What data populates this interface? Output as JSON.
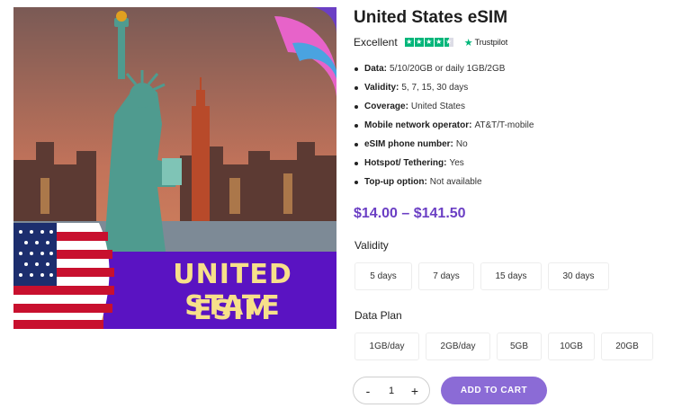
{
  "product": {
    "title": "United States eSIM",
    "image_text_line1": "UNITED STATE",
    "image_text_line2": "ESIM"
  },
  "rating": {
    "label": "Excellent",
    "stars": 4.5,
    "provider": "Trustpilot"
  },
  "features": [
    {
      "key": "Data:",
      "value": "5/10/20GB or daily 1GB/2GB"
    },
    {
      "key": "Validity:",
      "value": "5, 7, 15, 30 days"
    },
    {
      "key": "Coverage:",
      "value": "United States"
    },
    {
      "key": "Mobile network operator:",
      "value": "AT&T/T-mobile"
    },
    {
      "key": "eSIM phone number:",
      "value": "No"
    },
    {
      "key": "Hotspot/ Tethering:",
      "value": "Yes"
    },
    {
      "key": "Top-up option:",
      "value": "Not available"
    }
  ],
  "price": "$14.00 – $141.50",
  "validity": {
    "label": "Validity",
    "options": [
      "5 days",
      "7 days",
      "15 days",
      "30 days"
    ]
  },
  "data_plan": {
    "label": "Data Plan",
    "options": [
      "1GB/day",
      "2GB/day",
      "5GB",
      "10GB",
      "20GB"
    ]
  },
  "quantity": {
    "minus": "-",
    "value": "1",
    "plus": "+"
  },
  "add_to_cart": "ADD TO CART",
  "colors": {
    "accent": "#6b3fc4",
    "button": "#8b6bd6",
    "trustpilot": "#00b67a",
    "banner": "#5a13c2"
  }
}
